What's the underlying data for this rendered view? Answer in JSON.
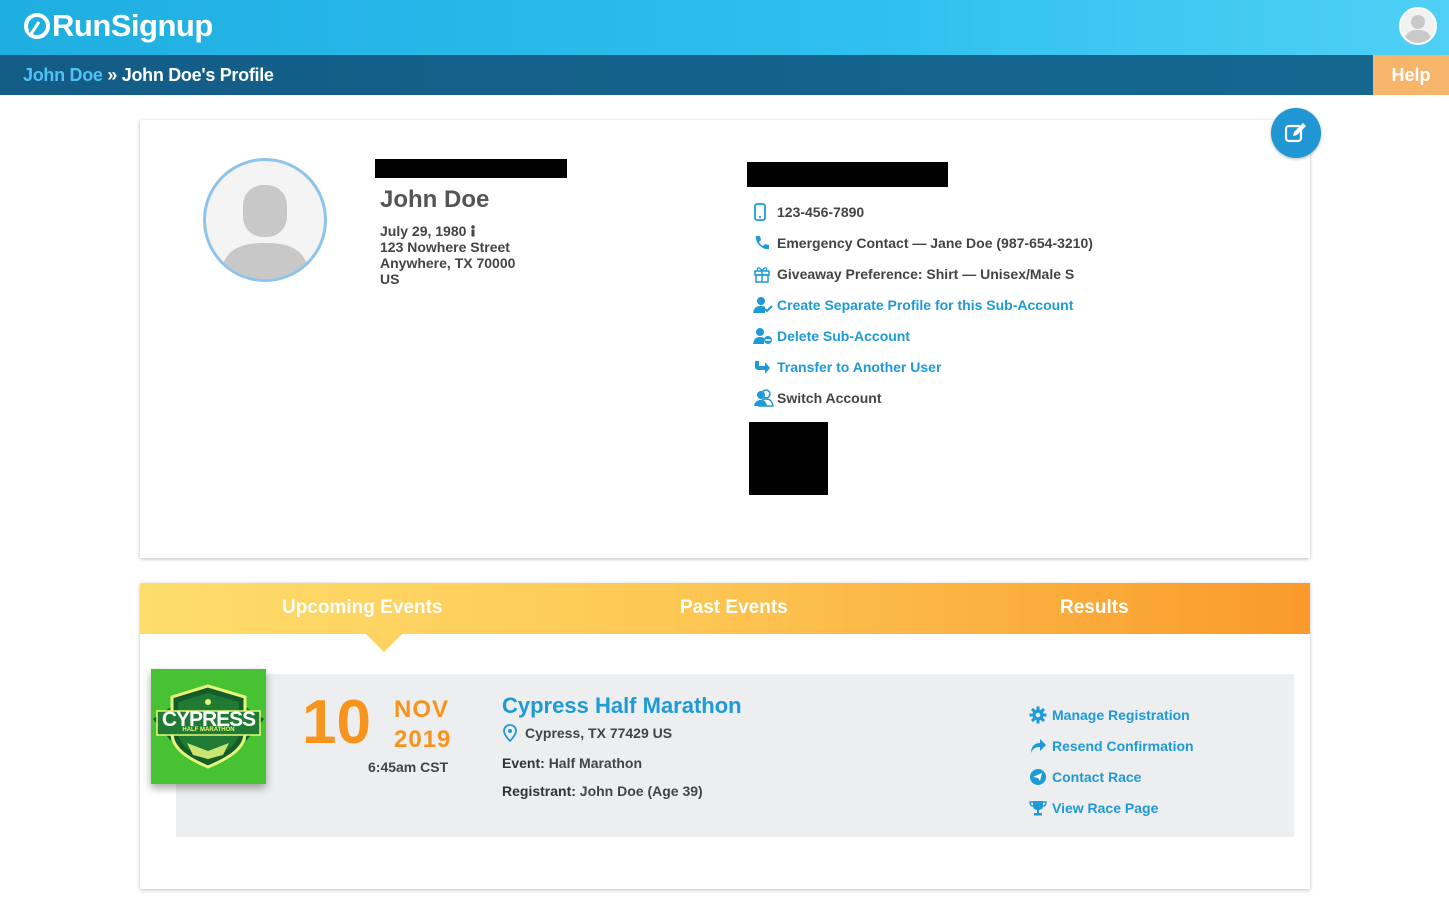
{
  "header": {
    "logo_text": "RunSignup",
    "colors": {
      "primary": "#1faee0",
      "dark": "#135c86",
      "accent": "#f7941d",
      "link": "#1e9ad6"
    }
  },
  "breadcrumb": {
    "link": "John Doe",
    "separator": "»",
    "current": "John Doe's Profile"
  },
  "help_label": "Help",
  "profile": {
    "name": "John Doe",
    "birthdate": "July 29, 1980",
    "address_line1": "123 Nowhere Street",
    "address_line2": "Anywhere, TX 70000",
    "country": "US",
    "phone": "123-456-7890",
    "emergency_contact": "Emergency Contact — Jane Doe (987-654-3210)",
    "giveaway": "Giveaway Preference: Shirt — Unisex/Male S",
    "actions": {
      "create_profile": "Create Separate Profile for this Sub-Account",
      "delete_sub": "Delete Sub-Account",
      "transfer": "Transfer to Another User",
      "switch": "Switch Account"
    }
  },
  "tabs": [
    {
      "label": "Upcoming Events",
      "active": true
    },
    {
      "label": "Past Events",
      "active": false
    },
    {
      "label": "Results",
      "active": false
    }
  ],
  "event": {
    "logo_text": "CYPRESS",
    "logo_subtext": "HALF MARATHON",
    "day": "10",
    "month": "NOV",
    "year": "2019",
    "time": "6:45am CST",
    "title": "Cypress Half Marathon",
    "location": "Cypress, TX 77429 US",
    "event_label": "Event:",
    "event_value": "Half Marathon",
    "registrant_label": "Registrant:",
    "registrant_value": "John Doe (Age 39)",
    "actions": {
      "manage": "Manage Registration",
      "resend": "Resend Confirmation",
      "contact": "Contact Race",
      "view": "View Race Page"
    }
  }
}
